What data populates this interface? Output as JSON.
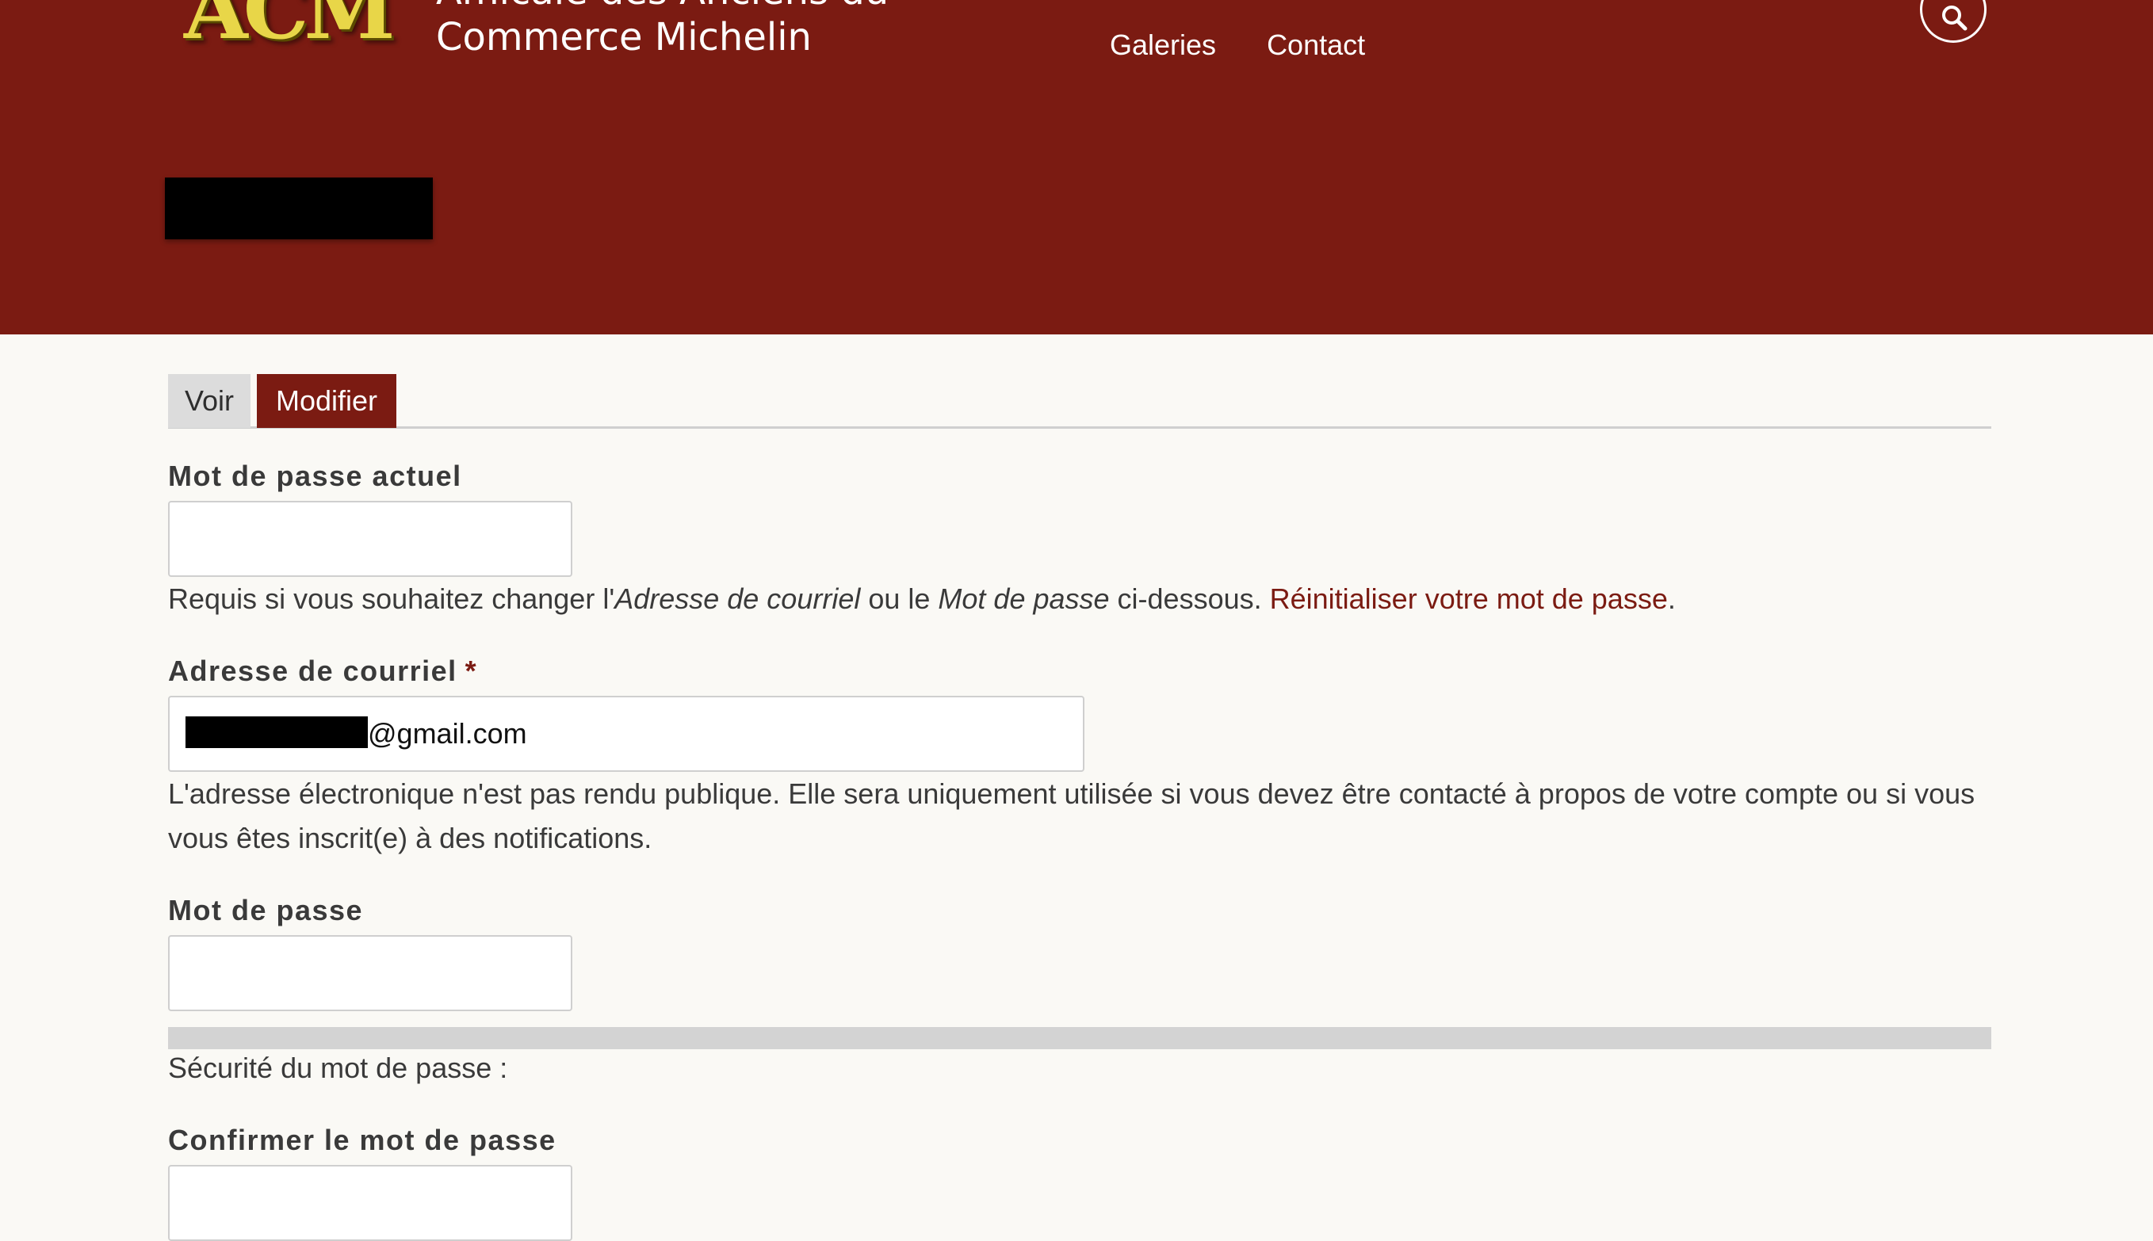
{
  "site": {
    "logo_text": "ACM",
    "name_line1": "Amicale des Anciens du",
    "name_line2": "Commerce Michelin"
  },
  "nav": {
    "items": [
      "Galeries",
      "Contact"
    ]
  },
  "icons": {
    "search": "search-icon"
  },
  "colors": {
    "brand": "#7b1b12",
    "background": "#faf9f5",
    "logo_gold": "#e8d648"
  },
  "tabs": {
    "view": "Voir",
    "edit": "Modifier",
    "active": "Modifier"
  },
  "form": {
    "current_password": {
      "label": "Mot de passe actuel",
      "value": "",
      "help_prefix": "Requis si vous souhaitez changer l'",
      "help_em1": "Adresse de courriel",
      "help_mid": " ou le ",
      "help_em2": "Mot de passe",
      "help_suffix": " ci-dessous. ",
      "reset_link": "Réinitialiser votre mot de passe",
      "reset_end": "."
    },
    "email": {
      "label": "Adresse de courriel",
      "required_mark": "*",
      "value": "@gmail.com",
      "help_line1": "L'adresse électronique n'est pas rendu publique. Elle sera uniquement utilisée si vous devez être contacté à propos de votre compte ou si vous",
      "help_line2": "vous êtes inscrit(e) à des notifications."
    },
    "password": {
      "label": "Mot de passe",
      "value": "",
      "strength_label": "Sécurité du mot de passe :",
      "strength_value": 0
    },
    "confirm_password": {
      "label": "Confirmer le mot de passe",
      "value": ""
    }
  }
}
